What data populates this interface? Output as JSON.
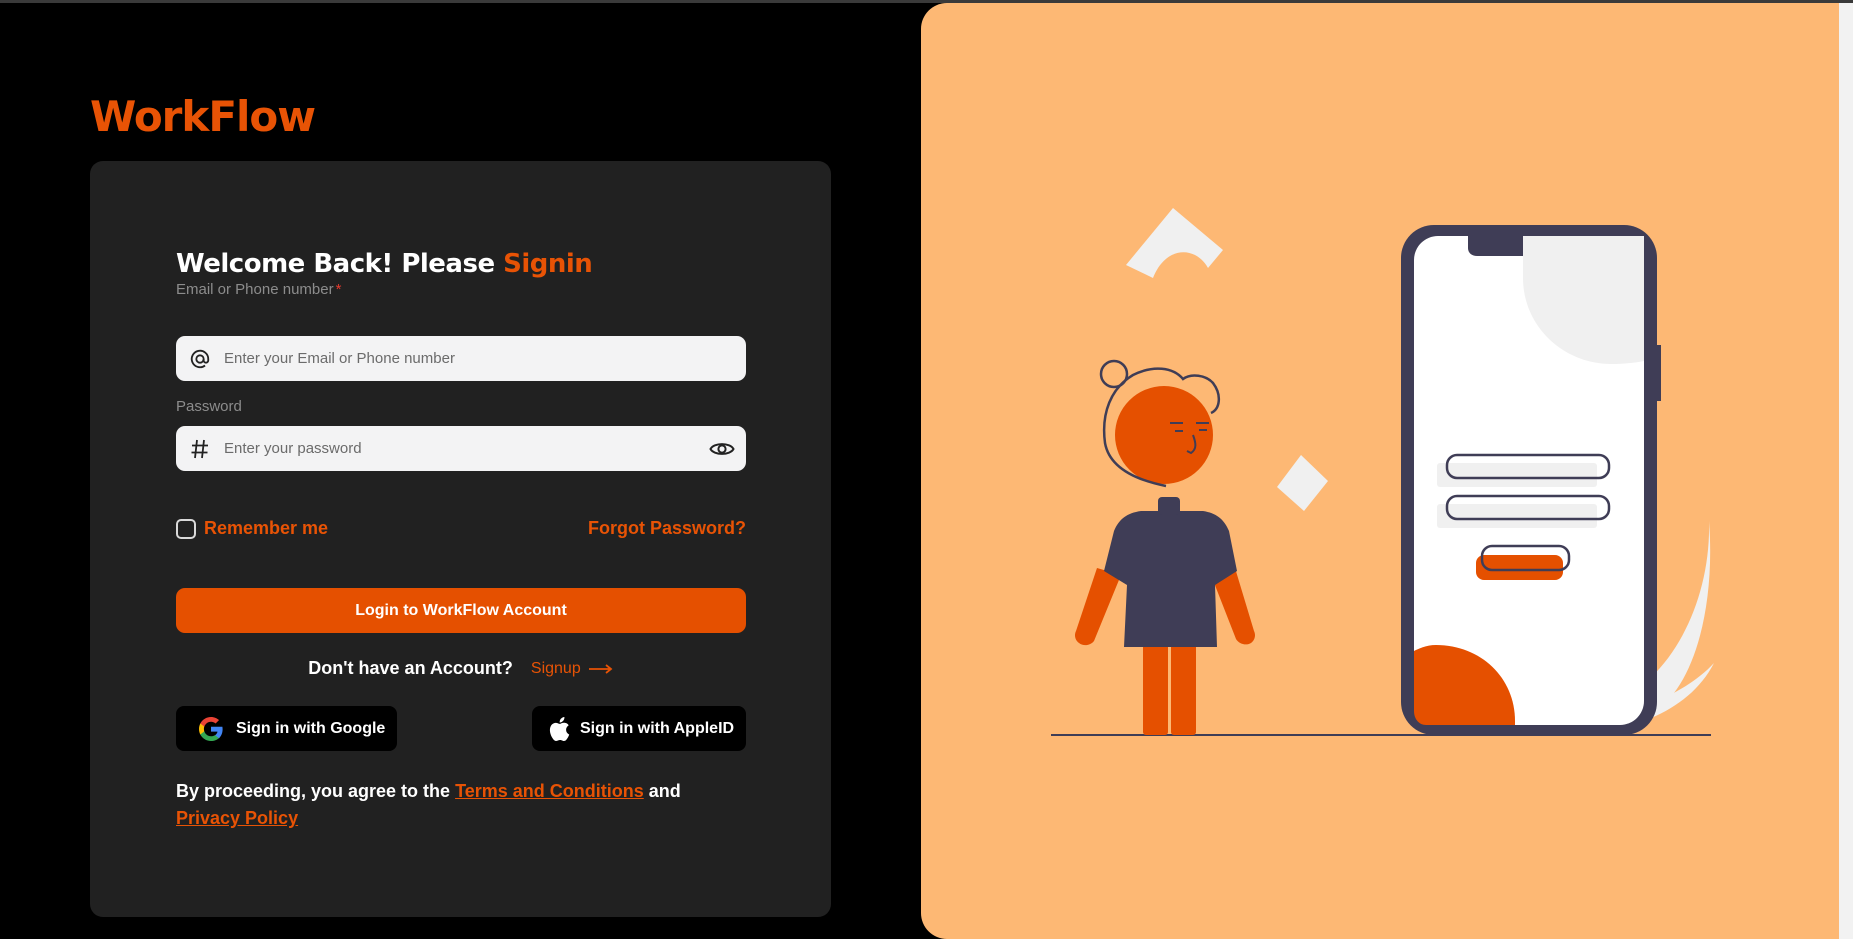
{
  "brand": {
    "logo": "WorkFlow"
  },
  "form": {
    "welcome_prefix": "Welcome Back! Please ",
    "welcome_accent": "Signin",
    "email_label": "Email or Phone number",
    "email_required_mark": "*",
    "email_placeholder": "Enter your Email or Phone number",
    "email_icon": "at-icon",
    "password_label": "Password",
    "password_placeholder": "Enter your password",
    "password_icon": "hash-icon",
    "password_toggle_icon": "eye-icon",
    "remember_label": "Remember me",
    "remember_checked": false,
    "forgot_label": "Forgot Password?",
    "login_button": "Login to WorkFlow Account",
    "no_account_text": "Don't have an Account?",
    "signup_label": "Signup",
    "google_button": "Sign in with Google",
    "apple_button": "Sign in with AppleID",
    "terms_prefix": "By proceeding, you agree to the ",
    "terms_link": "Terms and Conditions",
    "terms_and": " and ",
    "privacy_link": "Privacy Policy"
  },
  "colors": {
    "accent": "#e85305",
    "background": "#000000",
    "card": "#212121",
    "illustration_bg": "#fdb874",
    "dark_ink": "#3f3d56"
  }
}
